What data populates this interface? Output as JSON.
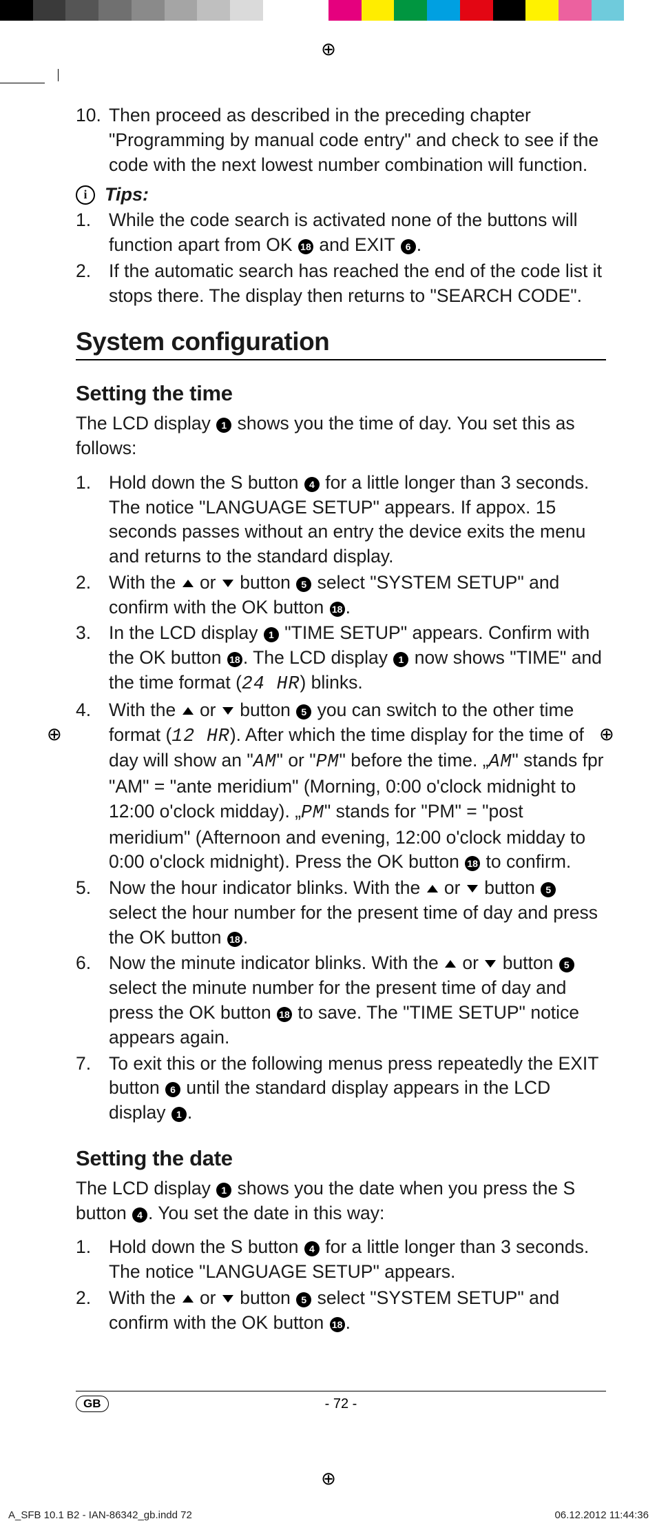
{
  "colorbar": [
    "#000000",
    "#3a3a3a",
    "#555555",
    "#707070",
    "#8a8a8a",
    "#a5a5a5",
    "#bfbfbf",
    "#dadada",
    "#ffffff",
    "#ffffff",
    "#e5007e",
    "#ffed00",
    "#009640",
    "#00a0e1",
    "#e30613",
    "#000000",
    "#fff200",
    "#ec619f",
    "#6fcbdc",
    "#ffffff"
  ],
  "cont": {
    "num": "10.",
    "text": "Then proceed as described in the preceding chapter \"Programming by manual code entry\" and check to see if the code with the next lowest number combination will function."
  },
  "tips": {
    "label": "Tips:",
    "items": [
      {
        "num": "1.",
        "pre": "While the code search is activated none of the buttons will function apart from OK ",
        "c1": "18",
        "mid": " and EXIT ",
        "c2": "6",
        "post": "."
      },
      {
        "num": "2.",
        "text": "If the automatic search has reached the end of the code list it stops there. The display then returns to \"SEARCH CODE\"."
      }
    ]
  },
  "h1": "System configuration",
  "time_h2": "Setting the time",
  "time_intro_pre": "The LCD display ",
  "time_intro_c": "1",
  "time_intro_post": " shows you the time of day. You set this as follows:",
  "time_steps": [
    {
      "num": "1.",
      "parts": [
        [
          "t",
          "Hold down the S button "
        ],
        [
          "c",
          "4"
        ],
        [
          "t",
          " for a little longer than 3 seconds. The notice \"LANGUAGE SETUP\" appears. If appox. 15 seconds passes without an entry the device exits the menu and returns to the standard display."
        ]
      ]
    },
    {
      "num": "2.",
      "parts": [
        [
          "t",
          "With the "
        ],
        [
          "up"
        ],
        [
          "t",
          " or "
        ],
        [
          "down"
        ],
        [
          "t",
          " button "
        ],
        [
          "c",
          "5"
        ],
        [
          "t",
          " select \"SYSTEM SETUP\" and confirm with the OK button "
        ],
        [
          "c",
          "18"
        ],
        [
          "t",
          "."
        ]
      ]
    },
    {
      "num": "3.",
      "parts": [
        [
          "t",
          "In the LCD display "
        ],
        [
          "c",
          "1"
        ],
        [
          "t",
          " \"TIME SETUP\" appears. Confirm with the OK button "
        ],
        [
          "c",
          "18"
        ],
        [
          "t",
          ".  The LCD display "
        ],
        [
          "c",
          "1"
        ],
        [
          "t",
          " now shows \"TIME\" and the time format ("
        ],
        [
          "seg",
          "24 HR"
        ],
        [
          "t",
          ") blinks."
        ]
      ]
    },
    {
      "num": "4.",
      "parts": [
        [
          "t",
          "With the "
        ],
        [
          "up"
        ],
        [
          "t",
          " or "
        ],
        [
          "down"
        ],
        [
          "t",
          " button "
        ],
        [
          "c",
          "5"
        ],
        [
          "t",
          " you can switch to the other time format ("
        ],
        [
          "seg",
          "12 HR"
        ],
        [
          "t",
          "). After which the time display for the time of day will show an \""
        ],
        [
          "seg",
          "AM"
        ],
        [
          "t",
          "\" or \""
        ],
        [
          "seg",
          "PM"
        ],
        [
          "t",
          "\" before the time. „"
        ],
        [
          "seg",
          "AM"
        ],
        [
          "t",
          "\" stands fpr \"AM\" = \"ante meridium\" (Morning, 0:00 o'clock midnight to 12:00 o'clock midday). „"
        ],
        [
          "seg",
          "PM"
        ],
        [
          "t",
          "\" stands for \"PM\" = \"post meridium\" (Afternoon and evening, 12:00 o'clock midday to 0:00 o'clock midnight). Press the OK button "
        ],
        [
          "c",
          "18"
        ],
        [
          "t",
          " to confirm."
        ]
      ]
    },
    {
      "num": "5.",
      "parts": [
        [
          "t",
          "Now the hour indicator blinks. With the "
        ],
        [
          "up"
        ],
        [
          "t",
          " or "
        ],
        [
          "down"
        ],
        [
          "t",
          " button "
        ],
        [
          "c",
          "5"
        ],
        [
          "t",
          " select the hour number for the present time of day and press the OK button "
        ],
        [
          "c",
          "18"
        ],
        [
          "t",
          "."
        ]
      ]
    },
    {
      "num": "6.",
      "parts": [
        [
          "t",
          "Now the minute indicator blinks. With the "
        ],
        [
          "up"
        ],
        [
          "t",
          " or "
        ],
        [
          "down"
        ],
        [
          "t",
          " button "
        ],
        [
          "c",
          "5"
        ],
        [
          "t",
          " select the minute number for the present time of day and press the OK button "
        ],
        [
          "c",
          "18"
        ],
        [
          "t",
          " to save. The \"TIME SETUP\" notice appears again."
        ]
      ]
    },
    {
      "num": "7.",
      "parts": [
        [
          "t",
          "To exit this or the following menus press repeatedly the EXIT button "
        ],
        [
          "c",
          "6"
        ],
        [
          "t",
          " until the standard display appears in the LCD display "
        ],
        [
          "c",
          "1"
        ],
        [
          "t",
          "."
        ]
      ]
    }
  ],
  "date_h2": "Setting the date",
  "date_intro": [
    [
      "t",
      "The LCD display "
    ],
    [
      "c",
      "1"
    ],
    [
      "t",
      " shows you the date when you press the S button "
    ],
    [
      "c",
      "4"
    ],
    [
      "t",
      ". You set the date in this way:"
    ]
  ],
  "date_steps": [
    {
      "num": "1.",
      "parts": [
        [
          "t",
          "Hold down the S button "
        ],
        [
          "c",
          "4"
        ],
        [
          "t",
          " for a little longer than 3 seconds. The notice \"LANGUAGE SETUP\" appears."
        ]
      ]
    },
    {
      "num": "2.",
      "parts": [
        [
          "t",
          "With the "
        ],
        [
          "up"
        ],
        [
          "t",
          " or "
        ],
        [
          "down"
        ],
        [
          "t",
          " button "
        ],
        [
          "c",
          "5"
        ],
        [
          "t",
          " select \"SYSTEM SETUP\" and confirm with the OK button "
        ],
        [
          "c",
          "18"
        ],
        [
          "t",
          "."
        ]
      ]
    }
  ],
  "footer": {
    "badge": "GB",
    "page": "- 72 -"
  },
  "slug": {
    "left": "A_SFB 10.1 B2 - IAN-86342_gb.indd   72",
    "right": "06.12.2012   11:44:36"
  }
}
